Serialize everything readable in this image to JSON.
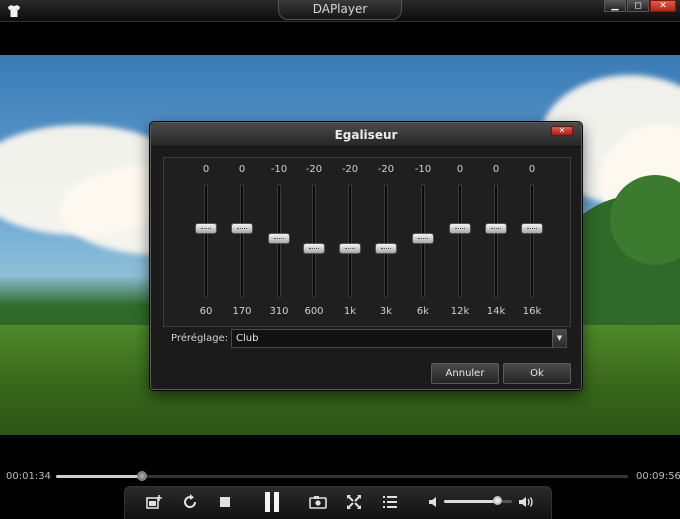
{
  "app": {
    "title": "DAPlayer"
  },
  "window_controls": {
    "minimize": "▁",
    "maximize": "◻",
    "close": "✕"
  },
  "equalizer": {
    "title": "Egaliseur",
    "bands": [
      {
        "value": "0",
        "freq": "60",
        "gain": 0
      },
      {
        "value": "0",
        "freq": "170",
        "gain": 0
      },
      {
        "value": "-10",
        "freq": "310",
        "gain": -10
      },
      {
        "value": "-20",
        "freq": "600",
        "gain": -20
      },
      {
        "value": "-20",
        "freq": "1k",
        "gain": -20
      },
      {
        "value": "-20",
        "freq": "3k",
        "gain": -20
      },
      {
        "value": "-10",
        "freq": "6k",
        "gain": -10
      },
      {
        "value": "0",
        "freq": "12k",
        "gain": 0
      },
      {
        "value": "0",
        "freq": "14k",
        "gain": 0
      },
      {
        "value": "0",
        "freq": "16k",
        "gain": 0
      }
    ],
    "preset_label": "Préréglage:",
    "preset_value": "Club",
    "cancel_label": "Annuler",
    "ok_label": "Ok"
  },
  "playback": {
    "current_time": "00:01:34",
    "total_time": "00:09:56",
    "progress": 0.15,
    "volume": 0.78
  },
  "icons": {
    "skin": "shirt-icon",
    "open": "add-file-icon",
    "repeat": "repeat-icon",
    "stop": "stop-icon",
    "pause": "pause-icon",
    "snapshot": "camera-icon",
    "fullscreen": "fullscreen-icon",
    "playlist": "playlist-icon",
    "volume_low": "speaker-low-icon",
    "volume_high": "speaker-high-icon"
  }
}
